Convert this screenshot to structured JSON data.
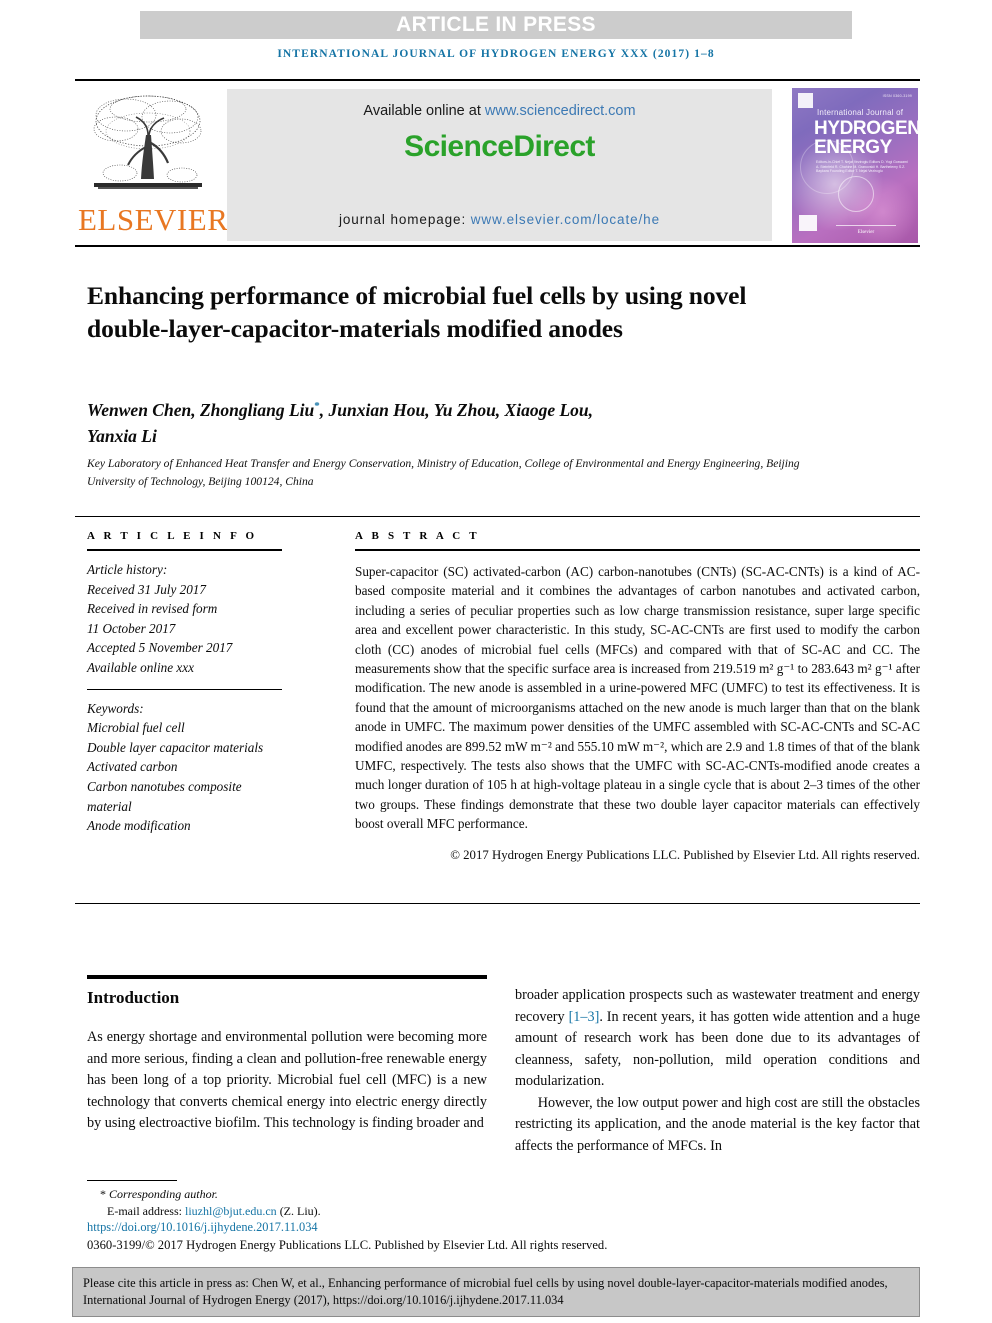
{
  "banner": {
    "label": "ARTICLE IN PRESS"
  },
  "running_head": "INTERNATIONAL JOURNAL OF HYDROGEN ENERGY XXX (2017) 1–8",
  "masthead": {
    "publisher_name": "ELSEVIER",
    "available_prefix": "Available online at ",
    "available_url": "www.sciencedirect.com",
    "brand": "ScienceDirect",
    "homepage_prefix": "journal homepage: ",
    "homepage_url": "www.elsevier.com/locate/he",
    "cover": {
      "issn": "ISSN 0360-3199",
      "line1": "International Journal of",
      "line2": "HYDROGEN",
      "line3": "ENERGY",
      "editors": "Editors-in-Chief  T. Nejat Veziroglu   Editors  D. Yogi Goswami   A. Steinfeld   R. Chahine   M. Granovskii   H. Barthelemy   S.Z. Baykara   Founding Editor  T. Nejat Veziroglu",
      "publisher": "Elsevier"
    }
  },
  "title": "Enhancing performance of microbial fuel cells by using novel double-layer-capacitor-materials modified anodes",
  "authors": {
    "line1_before_star": "Wenwen Chen, Zhongliang Liu",
    "star": "*",
    "line1_after_star": ", Junxian Hou, Yu Zhou, Xiaoge Lou,",
    "line2": "Yanxia Li"
  },
  "affiliation": "Key Laboratory of Enhanced Heat Transfer and Energy Conservation, Ministry of Education, College of Environmental and Energy Engineering, Beijing University of Technology, Beijing 100124, China",
  "article_info": {
    "heading": "A R T I C L E  I N F O",
    "history_label": "Article history:",
    "history": [
      "Received 31 July 2017",
      "Received in revised form",
      "11 October 2017",
      "Accepted 5 November 2017",
      "Available online xxx"
    ],
    "keywords_label": "Keywords:",
    "keywords": [
      "Microbial fuel cell",
      "Double layer capacitor materials",
      "Activated carbon",
      "Carbon nanotubes composite",
      "material",
      "Anode modification"
    ]
  },
  "abstract": {
    "heading": "A B S T R A C T",
    "body": "Super-capacitor (SC) activated-carbon (AC) carbon-nanotubes (CNTs) (SC-AC-CNTs) is a kind of AC-based composite material and it combines the advantages of carbon nanotubes and activated carbon, including a series of peculiar properties such as low charge transmission resistance, super large specific area and excellent power characteristic. In this study, SC-AC-CNTs are first used to modify the carbon cloth (CC) anodes of microbial fuel cells (MFCs) and compared with that of SC-AC and CC. The measurements show that the specific surface area is increased from 219.519 m² g⁻¹ to 283.643 m² g⁻¹ after modification. The new anode is assembled in a urine-powered MFC (UMFC) to test its effectiveness. It is found that the amount of microorganisms attached on the new anode is much larger than that on the blank anode in UMFC. The maximum power densities of the UMFC assembled with SC-AC-CNTs and SC-AC modified anodes are 899.52 mW m⁻² and 555.10 mW m⁻², which are 2.9 and 1.8 times of that of the blank UMFC, respectively. The tests also shows that the UMFC with SC-AC-CNTs-modified anode creates a much longer duration of 105 h at high-voltage plateau in a single cycle that is about 2–3 times of the other two groups. These findings demonstrate that these two double layer capacitor materials can effectively boost overall MFC performance.",
    "copyright": "© 2017 Hydrogen Energy Publications LLC. Published by Elsevier Ltd. All rights reserved."
  },
  "introduction": {
    "heading": "Introduction",
    "left_paragraph": "As energy shortage and environmental pollution were becoming more and more serious, finding a clean and pollution-free renewable energy has been long of a top priority. Microbial fuel cell (MFC) is a new technology that converts chemical energy into electric energy directly by using electroactive biofilm. This technology is finding broader and",
    "right_paragraph_1_before_ref": "broader application prospects such as wastewater treatment and energy recovery ",
    "right_paragraph_1_ref": "[1–3]",
    "right_paragraph_1_after_ref": ". In recent years, it has gotten wide attention and a huge amount of research work has been done due to its advantages of cleanness, safety, non-pollution, mild operation conditions and modularization.",
    "right_paragraph_2": "However, the low output power and high cost are still the obstacles restricting its application, and the anode material is the key factor that affects the performance of MFCs. In"
  },
  "footnote": {
    "corresponding_star": "*",
    "corresponding_label": "Corresponding author.",
    "email_label": "E-mail address: ",
    "email": "liuzhl@bjut.edu.cn",
    "email_suffix": " (Z. Liu).",
    "doi": "https://doi.org/10.1016/j.ijhydene.2017.11.034",
    "issn_line": "0360-3199/© 2017 Hydrogen Energy Publications LLC. Published by Elsevier Ltd. All rights reserved."
  },
  "cite_box": {
    "text": "Please cite this article in press as: Chen W, et al., Enhancing performance of microbial fuel cells by using novel double-layer-capacitor-materials modified anodes, International Journal of Hydrogen Energy (2017), https://doi.org/10.1016/j.ijhydene.2017.11.034"
  },
  "colors": {
    "link_blue": "#1574a5",
    "sd_green": "#2aa22a",
    "elsevier_orange": "#e87722",
    "banner_gray": "#cccccc",
    "panel_gray": "#e5e5e5",
    "cite_gray": "#c7c7c7"
  }
}
